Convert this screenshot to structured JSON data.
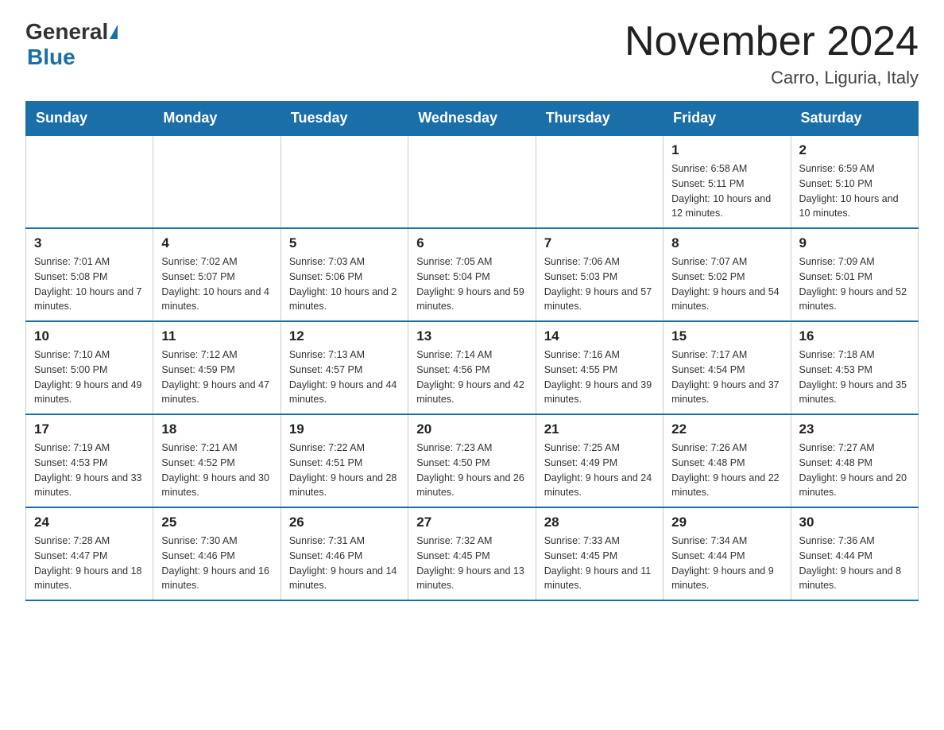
{
  "header": {
    "logo_general": "General",
    "logo_blue": "Blue",
    "title": "November 2024",
    "location": "Carro, Liguria, Italy"
  },
  "days_of_week": [
    "Sunday",
    "Monday",
    "Tuesday",
    "Wednesday",
    "Thursday",
    "Friday",
    "Saturday"
  ],
  "weeks": [
    [
      {
        "day": "",
        "info": ""
      },
      {
        "day": "",
        "info": ""
      },
      {
        "day": "",
        "info": ""
      },
      {
        "day": "",
        "info": ""
      },
      {
        "day": "",
        "info": ""
      },
      {
        "day": "1",
        "info": "Sunrise: 6:58 AM\nSunset: 5:11 PM\nDaylight: 10 hours and 12 minutes."
      },
      {
        "day": "2",
        "info": "Sunrise: 6:59 AM\nSunset: 5:10 PM\nDaylight: 10 hours and 10 minutes."
      }
    ],
    [
      {
        "day": "3",
        "info": "Sunrise: 7:01 AM\nSunset: 5:08 PM\nDaylight: 10 hours and 7 minutes."
      },
      {
        "day": "4",
        "info": "Sunrise: 7:02 AM\nSunset: 5:07 PM\nDaylight: 10 hours and 4 minutes."
      },
      {
        "day": "5",
        "info": "Sunrise: 7:03 AM\nSunset: 5:06 PM\nDaylight: 10 hours and 2 minutes."
      },
      {
        "day": "6",
        "info": "Sunrise: 7:05 AM\nSunset: 5:04 PM\nDaylight: 9 hours and 59 minutes."
      },
      {
        "day": "7",
        "info": "Sunrise: 7:06 AM\nSunset: 5:03 PM\nDaylight: 9 hours and 57 minutes."
      },
      {
        "day": "8",
        "info": "Sunrise: 7:07 AM\nSunset: 5:02 PM\nDaylight: 9 hours and 54 minutes."
      },
      {
        "day": "9",
        "info": "Sunrise: 7:09 AM\nSunset: 5:01 PM\nDaylight: 9 hours and 52 minutes."
      }
    ],
    [
      {
        "day": "10",
        "info": "Sunrise: 7:10 AM\nSunset: 5:00 PM\nDaylight: 9 hours and 49 minutes."
      },
      {
        "day": "11",
        "info": "Sunrise: 7:12 AM\nSunset: 4:59 PM\nDaylight: 9 hours and 47 minutes."
      },
      {
        "day": "12",
        "info": "Sunrise: 7:13 AM\nSunset: 4:57 PM\nDaylight: 9 hours and 44 minutes."
      },
      {
        "day": "13",
        "info": "Sunrise: 7:14 AM\nSunset: 4:56 PM\nDaylight: 9 hours and 42 minutes."
      },
      {
        "day": "14",
        "info": "Sunrise: 7:16 AM\nSunset: 4:55 PM\nDaylight: 9 hours and 39 minutes."
      },
      {
        "day": "15",
        "info": "Sunrise: 7:17 AM\nSunset: 4:54 PM\nDaylight: 9 hours and 37 minutes."
      },
      {
        "day": "16",
        "info": "Sunrise: 7:18 AM\nSunset: 4:53 PM\nDaylight: 9 hours and 35 minutes."
      }
    ],
    [
      {
        "day": "17",
        "info": "Sunrise: 7:19 AM\nSunset: 4:53 PM\nDaylight: 9 hours and 33 minutes."
      },
      {
        "day": "18",
        "info": "Sunrise: 7:21 AM\nSunset: 4:52 PM\nDaylight: 9 hours and 30 minutes."
      },
      {
        "day": "19",
        "info": "Sunrise: 7:22 AM\nSunset: 4:51 PM\nDaylight: 9 hours and 28 minutes."
      },
      {
        "day": "20",
        "info": "Sunrise: 7:23 AM\nSunset: 4:50 PM\nDaylight: 9 hours and 26 minutes."
      },
      {
        "day": "21",
        "info": "Sunrise: 7:25 AM\nSunset: 4:49 PM\nDaylight: 9 hours and 24 minutes."
      },
      {
        "day": "22",
        "info": "Sunrise: 7:26 AM\nSunset: 4:48 PM\nDaylight: 9 hours and 22 minutes."
      },
      {
        "day": "23",
        "info": "Sunrise: 7:27 AM\nSunset: 4:48 PM\nDaylight: 9 hours and 20 minutes."
      }
    ],
    [
      {
        "day": "24",
        "info": "Sunrise: 7:28 AM\nSunset: 4:47 PM\nDaylight: 9 hours and 18 minutes."
      },
      {
        "day": "25",
        "info": "Sunrise: 7:30 AM\nSunset: 4:46 PM\nDaylight: 9 hours and 16 minutes."
      },
      {
        "day": "26",
        "info": "Sunrise: 7:31 AM\nSunset: 4:46 PM\nDaylight: 9 hours and 14 minutes."
      },
      {
        "day": "27",
        "info": "Sunrise: 7:32 AM\nSunset: 4:45 PM\nDaylight: 9 hours and 13 minutes."
      },
      {
        "day": "28",
        "info": "Sunrise: 7:33 AM\nSunset: 4:45 PM\nDaylight: 9 hours and 11 minutes."
      },
      {
        "day": "29",
        "info": "Sunrise: 7:34 AM\nSunset: 4:44 PM\nDaylight: 9 hours and 9 minutes."
      },
      {
        "day": "30",
        "info": "Sunrise: 7:36 AM\nSunset: 4:44 PM\nDaylight: 9 hours and 8 minutes."
      }
    ]
  ]
}
